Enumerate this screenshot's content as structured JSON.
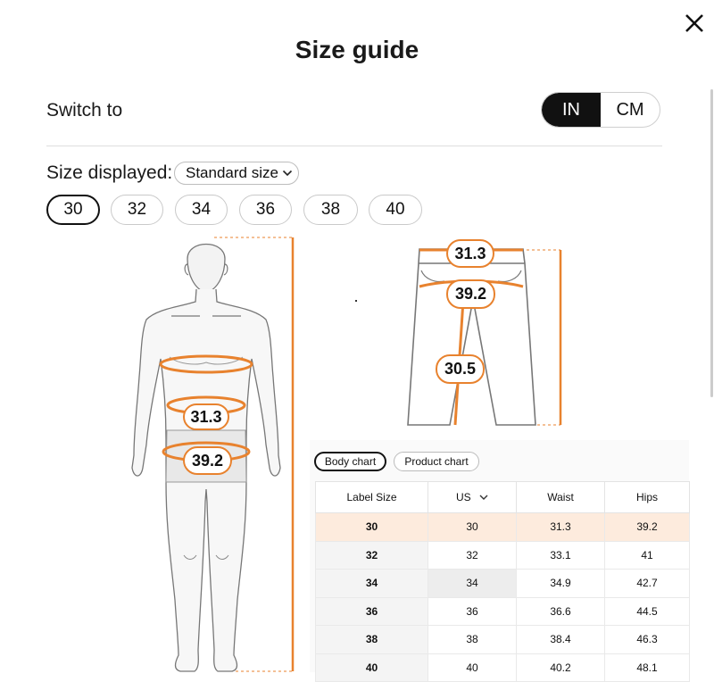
{
  "dialog": {
    "title": "Size guide",
    "close_icon": "close-icon"
  },
  "units": {
    "label": "Switch to",
    "options": [
      "IN",
      "CM"
    ],
    "selected": "IN"
  },
  "size_display": {
    "label": "Size displayed:",
    "dropdown_value": "Standard size"
  },
  "sizes": {
    "options": [
      "30",
      "32",
      "34",
      "36",
      "38",
      "40"
    ],
    "selected": "30"
  },
  "body_figure": {
    "waist": "31.3",
    "hips": "39.2"
  },
  "pants_figure": {
    "waist": "31.3",
    "hips": "39.2",
    "inseam": "30.5"
  },
  "chart_tabs": {
    "body": "Body chart",
    "product": "Product chart",
    "active": "Body chart"
  },
  "table": {
    "headers": [
      "Label Size",
      "US",
      "Waist",
      "Hips"
    ],
    "rows": [
      [
        "30",
        "30",
        "31.3",
        "39.2"
      ],
      [
        "32",
        "32",
        "33.1",
        "41"
      ],
      [
        "34",
        "34",
        "34.9",
        "42.7"
      ],
      [
        "36",
        "36",
        "36.6",
        "44.5"
      ],
      [
        "38",
        "38",
        "38.4",
        "46.3"
      ],
      [
        "40",
        "40",
        "40.2",
        "48.1"
      ]
    ]
  },
  "colors": {
    "accent": "#E8822E",
    "active": "#111111",
    "highlight_row": "#FDEBDD"
  }
}
